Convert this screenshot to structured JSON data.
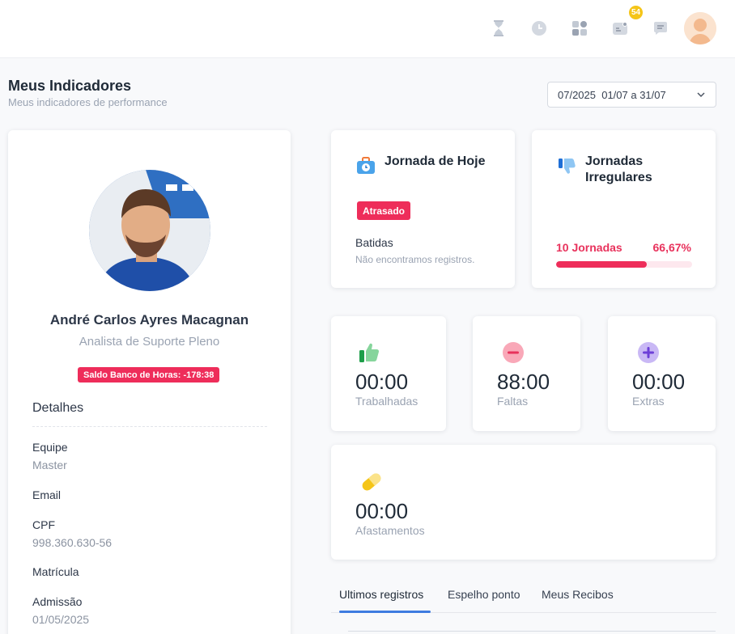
{
  "topbar": {
    "icons": [
      "hourglass-icon",
      "clock-icon",
      "apps-grid-icon",
      "notifications-icon",
      "chat-icon"
    ],
    "notification_count": "54"
  },
  "header": {
    "title": "Meus Indicadores",
    "subtitle": "Meus indicadores de performance"
  },
  "period_select": {
    "value": "07/2025  01/07 a 31/07"
  },
  "profile": {
    "name": "André Carlos Ayres Macagnan",
    "role": "Analista de Suporte Pleno",
    "saldo_badge": "Saldo Banco de Horas: -178:38",
    "details_title": "Detalhes",
    "details": [
      {
        "label": "Equipe",
        "value": "Master"
      },
      {
        "label": "Email",
        "value": ""
      },
      {
        "label": "CPF",
        "value": "998.360.630-56"
      },
      {
        "label": "Matrícula",
        "value": ""
      },
      {
        "label": "Admissão",
        "value": "01/05/2025"
      }
    ]
  },
  "jornada_hoje": {
    "title": "Jornada de Hoje",
    "status": "Atrasado",
    "batidas_label": "Batidas",
    "batidas_empty": "Não encontramos registros."
  },
  "jornadas_irregulares": {
    "title": "Jornadas Irregulares",
    "count_label": "10 Jornadas",
    "percent_label": "66,67%",
    "percent": 66.67
  },
  "stats": {
    "trabalhadas": {
      "value": "00:00",
      "label": "Trabalhadas"
    },
    "faltas": {
      "value": "88:00",
      "label": "Faltas"
    },
    "extras": {
      "value": "00:00",
      "label": "Extras"
    },
    "afastamentos": {
      "value": "00:00",
      "label": "Afastamentos"
    }
  },
  "tabs": [
    {
      "label": "Ultimos registros"
    },
    {
      "label": "Espelho ponto"
    },
    {
      "label": "Meus Recibos"
    }
  ],
  "colors": {
    "accent_red": "#ee2d5a",
    "tab_active": "#3e7be0",
    "badge_yellow": "#f5c518"
  }
}
